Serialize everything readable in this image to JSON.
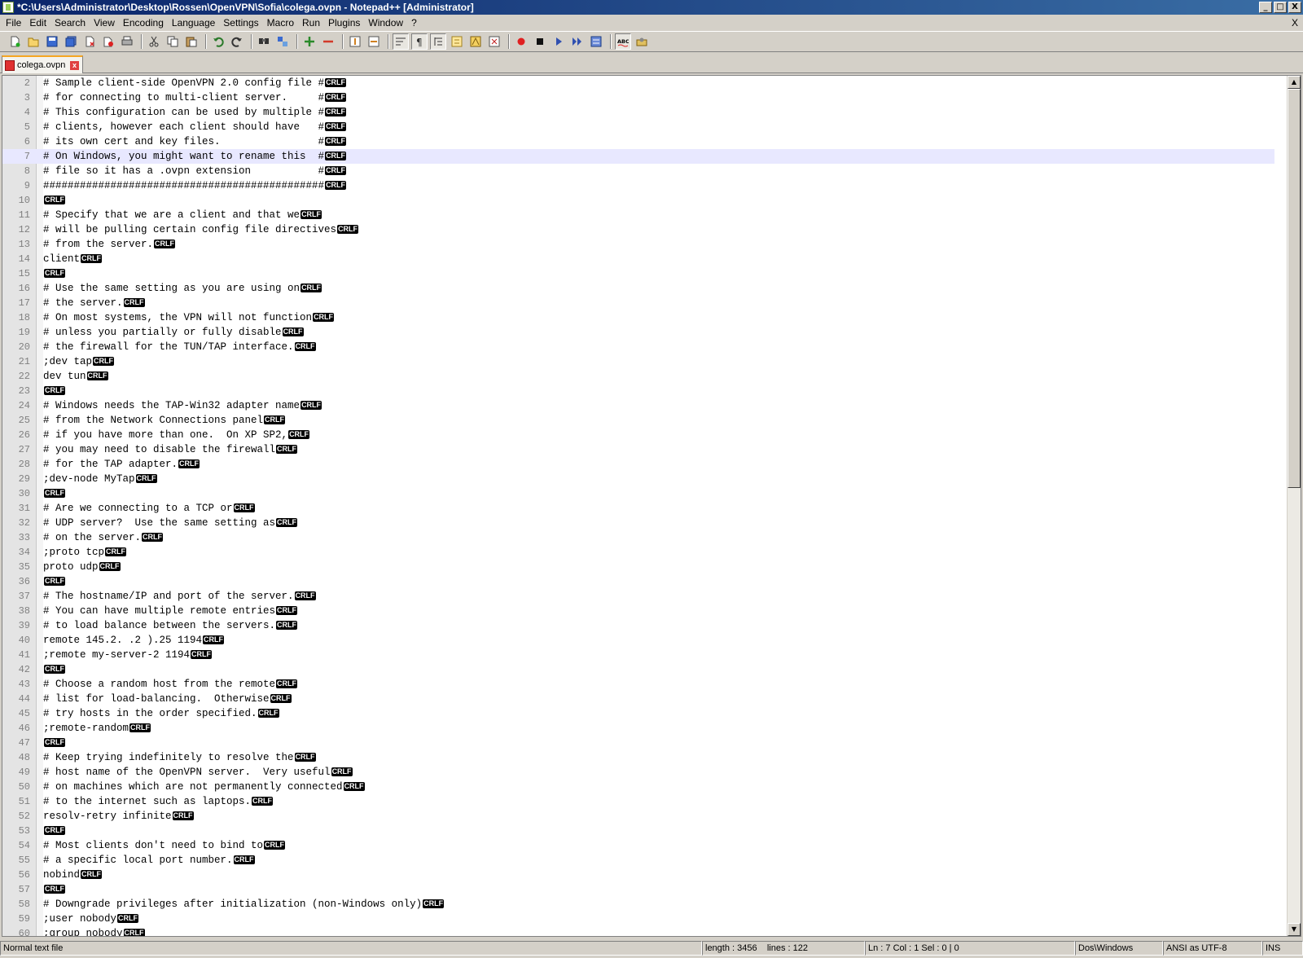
{
  "window": {
    "title": "*C:\\Users\\Administrator\\Desktop\\Rossen\\OpenVPN\\Sofia\\colega.ovpn - Notepad++ [Administrator]",
    "minimize": "_",
    "maximize": "□",
    "close": "X"
  },
  "menu": {
    "items": [
      "File",
      "Edit",
      "Search",
      "View",
      "Encoding",
      "Language",
      "Settings",
      "Macro",
      "Run",
      "Plugins",
      "Window",
      "?"
    ],
    "close_doc": "X"
  },
  "tab": {
    "label": "colega.ovpn",
    "close": "x"
  },
  "eol_marker": "CRLF",
  "current_line": 7,
  "lines": [
    {
      "n": "2",
      "t": "# Sample client-side OpenVPN 2.0 config file #"
    },
    {
      "n": "3",
      "t": "# for connecting to multi-client server.     #"
    },
    {
      "n": "4",
      "t": "# This configuration can be used by multiple #"
    },
    {
      "n": "5",
      "t": "# clients, however each client should have   #"
    },
    {
      "n": "6",
      "t": "# its own cert and key files.                #"
    },
    {
      "n": "7",
      "t": "# On Windows, you might want to rename this  #"
    },
    {
      "n": "8",
      "t": "# file so it has a .ovpn extension           #"
    },
    {
      "n": "9",
      "t": "##############################################"
    },
    {
      "n": "10",
      "t": ""
    },
    {
      "n": "11",
      "t": "# Specify that we are a client and that we"
    },
    {
      "n": "12",
      "t": "# will be pulling certain config file directives"
    },
    {
      "n": "13",
      "t": "# from the server."
    },
    {
      "n": "14",
      "t": "client"
    },
    {
      "n": "15",
      "t": ""
    },
    {
      "n": "16",
      "t": "# Use the same setting as you are using on"
    },
    {
      "n": "17",
      "t": "# the server."
    },
    {
      "n": "18",
      "t": "# On most systems, the VPN will not function"
    },
    {
      "n": "19",
      "t": "# unless you partially or fully disable"
    },
    {
      "n": "20",
      "t": "# the firewall for the TUN/TAP interface."
    },
    {
      "n": "21",
      "t": ";dev tap"
    },
    {
      "n": "22",
      "t": "dev tun"
    },
    {
      "n": "23",
      "t": ""
    },
    {
      "n": "24",
      "t": "# Windows needs the TAP-Win32 adapter name"
    },
    {
      "n": "25",
      "t": "# from the Network Connections panel"
    },
    {
      "n": "26",
      "t": "# if you have more than one.  On XP SP2,"
    },
    {
      "n": "27",
      "t": "# you may need to disable the firewall"
    },
    {
      "n": "28",
      "t": "# for the TAP adapter."
    },
    {
      "n": "29",
      "t": ";dev-node MyTap"
    },
    {
      "n": "30",
      "t": ""
    },
    {
      "n": "31",
      "t": "# Are we connecting to a TCP or"
    },
    {
      "n": "32",
      "t": "# UDP server?  Use the same setting as"
    },
    {
      "n": "33",
      "t": "# on the server."
    },
    {
      "n": "34",
      "t": ";proto tcp"
    },
    {
      "n": "35",
      "t": "proto udp"
    },
    {
      "n": "36",
      "t": ""
    },
    {
      "n": "37",
      "t": "# The hostname/IP and port of the server."
    },
    {
      "n": "38",
      "t": "# You can have multiple remote entries"
    },
    {
      "n": "39",
      "t": "# to load balance between the servers."
    },
    {
      "n": "40",
      "t": "remote 145.2. .2 ).25 1194"
    },
    {
      "n": "41",
      "t": ";remote my-server-2 1194"
    },
    {
      "n": "42",
      "t": ""
    },
    {
      "n": "43",
      "t": "# Choose a random host from the remote"
    },
    {
      "n": "44",
      "t": "# list for load-balancing.  Otherwise"
    },
    {
      "n": "45",
      "t": "# try hosts in the order specified."
    },
    {
      "n": "46",
      "t": ";remote-random"
    },
    {
      "n": "47",
      "t": ""
    },
    {
      "n": "48",
      "t": "# Keep trying indefinitely to resolve the"
    },
    {
      "n": "49",
      "t": "# host name of the OpenVPN server.  Very useful"
    },
    {
      "n": "50",
      "t": "# on machines which are not permanently connected"
    },
    {
      "n": "51",
      "t": "# to the internet such as laptops."
    },
    {
      "n": "52",
      "t": "resolv-retry infinite"
    },
    {
      "n": "53",
      "t": ""
    },
    {
      "n": "54",
      "t": "# Most clients don't need to bind to"
    },
    {
      "n": "55",
      "t": "# a specific local port number."
    },
    {
      "n": "56",
      "t": "nobind"
    },
    {
      "n": "57",
      "t": ""
    },
    {
      "n": "58",
      "t": "# Downgrade privileges after initialization (non-Windows only)"
    },
    {
      "n": "59",
      "t": ";user nobody"
    },
    {
      "n": "60",
      "t": ";group nobody"
    }
  ],
  "status": {
    "file_type": "Normal text file",
    "length": "length : 3456",
    "lines": "lines : 122",
    "position": "Ln : 7    Col : 1    Sel : 0 | 0",
    "eol": "Dos\\Windows",
    "encoding": "ANSI as UTF-8",
    "mode": "INS"
  },
  "toolbar_icons": [
    "new-file-icon",
    "open-file-icon",
    "save-icon",
    "save-all-icon",
    "close-icon",
    "close-all-icon",
    "print-icon",
    "cut-icon",
    "copy-icon",
    "paste-icon",
    "undo-icon",
    "redo-icon",
    "find-icon",
    "replace-icon",
    "zoom-in-icon",
    "zoom-out-icon",
    "sync-vertical-icon",
    "sync-horizontal-icon",
    "word-wrap-icon",
    "show-all-chars-icon",
    "indent-guide-icon",
    "user-lang-icon",
    "doc-map-icon",
    "function-list-icon",
    "record-macro-icon",
    "stop-record-icon",
    "play-macro-icon",
    "run-macro-multiple-icon",
    "save-macro-icon",
    "spell-check-icon",
    "spell-options-icon"
  ]
}
